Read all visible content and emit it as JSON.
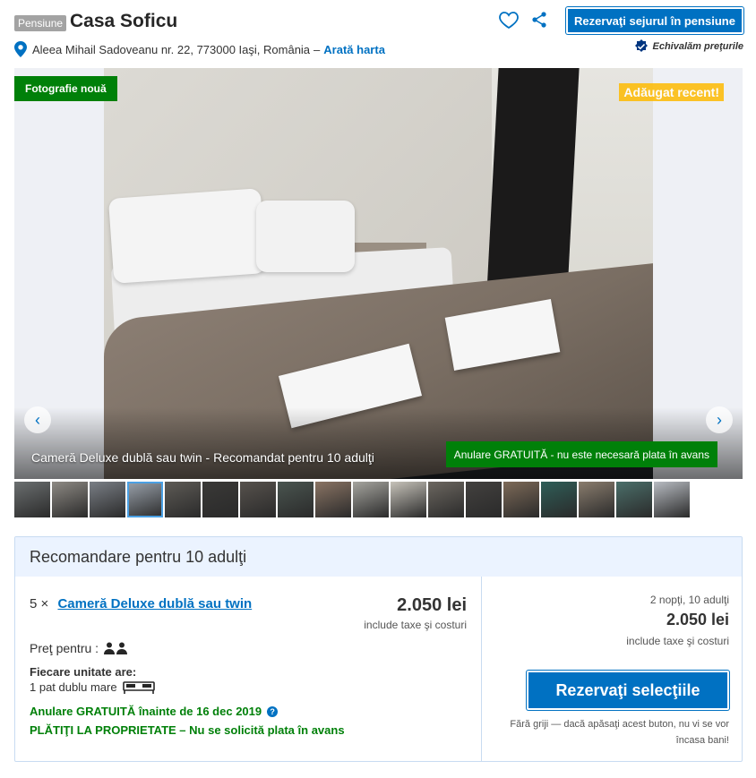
{
  "header": {
    "type_badge": "Pensiune",
    "title": "Casa Soficu",
    "reserve_button": "Rezervaţi sejurul în pensiune",
    "address": "Aleea Mihail Sadoveanu nr. 22, 773000 Iaşi, România",
    "separator": "–",
    "map_link": "Arată harta",
    "price_match": "Echivalăm preţurile"
  },
  "gallery": {
    "badge_new": "Fotografie nouă",
    "badge_recent": "Adăugat recent!",
    "caption": "Cameră Deluxe dublă sau twin - Recomandat pentru 10 adulţi",
    "free_cancel": "Anulare GRATUITĂ - nu este necesară plata în avans",
    "prev_icon": "chevron-left-icon",
    "next_icon": "chevron-right-icon",
    "prev_glyph": "‹",
    "next_glyph": "›",
    "thumbs": [
      "#6b6f70",
      "#8e8a84",
      "#7a7f86",
      "#9ba3ad",
      "#5e5b56",
      "#3a3937",
      "#57524d",
      "#4a5550",
      "#8a7464",
      "#a6a59f",
      "#c7c3ba",
      "#6c6760",
      "#43413f",
      "#7d6a58",
      "#2f5e58",
      "#8a7d6e",
      "#4b6f6a",
      "#b8bcc2"
    ],
    "active_thumb": 3
  },
  "recommendation": {
    "title": "Recomandare pentru 10 adulţi",
    "quantity": "5 ×",
    "room_name": "Cameră Deluxe dublă sau twin",
    "price": "2.050 lei",
    "tax_note": "include taxe şi costuri",
    "price_for_label": "Preţ pentru :",
    "unit_title": "Fiecare unitate are:",
    "unit_bed": "1 pat dublu mare",
    "free_cancel": "Anulare GRATUITĂ înainte de 16 dec 2019",
    "pay_at_property": "PLĂTIŢI LA PROPRIETATE – Nu se solicită plata în avans",
    "help_icon_glyph": "?",
    "summary_nights": "2 nopţi, 10 adulţi",
    "summary_price": "2.050 lei",
    "summary_tax": "include taxe şi costuri",
    "reserve_button": "Rezervaţi selecţiile",
    "no_worry": "Fără griji — dacă apăsaţi acest buton, nu vi se vor încasa bani!"
  },
  "colors": {
    "brand_blue": "#0071c2",
    "green": "#008009",
    "yellow": "#febb02",
    "light_blue_bg": "#ebf3ff"
  }
}
